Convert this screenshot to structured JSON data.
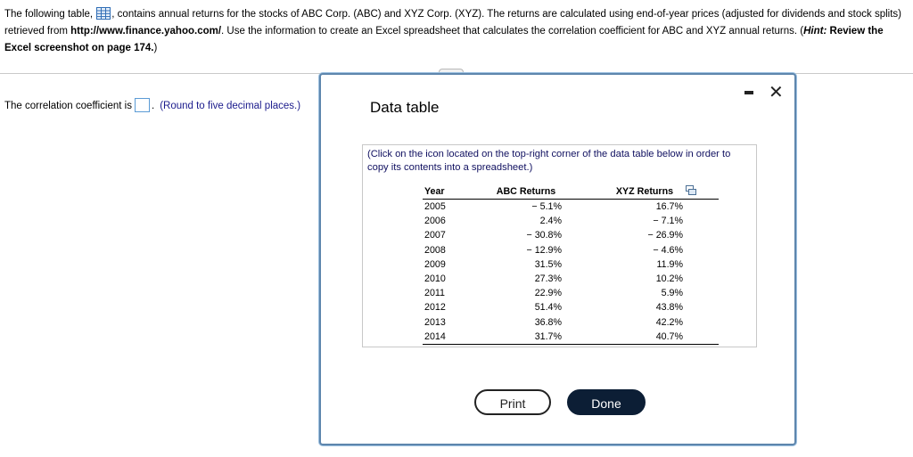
{
  "problem": {
    "part1": "The following table, ",
    "part2": ", contains annual returns for the stocks of ABC Corp. (ABC) and XYZ Corp. (XYZ). The returns are calculated using end-of-year prices (adjusted for dividends and stock splits) retrieved from ",
    "url": "http://www.finance.yahoo.com/",
    "part3": ". Use the information to create an Excel spreadsheet that calculates the correlation coefficient for ABC and XYZ annual returns. (",
    "hint_label": "Hint:",
    "hint_text": " Review the Excel screenshot on page 174.",
    "part4": ")"
  },
  "answer": {
    "prefix": "The correlation coefficient is",
    "suffix": ".",
    "hint": "(Round to five decimal places.)",
    "value": ""
  },
  "modal": {
    "title": "Data table",
    "instructions": "(Click on the icon located on the top-right corner of the data table below in order to copy its contents into a spreadsheet.)",
    "columns": [
      "Year",
      "ABC Returns",
      "XYZ Returns"
    ],
    "rows": [
      [
        "2005",
        "− 5.1%",
        "16.7%"
      ],
      [
        "2006",
        "2.4%",
        "− 7.1%"
      ],
      [
        "2007",
        "− 30.8%",
        "− 26.9%"
      ],
      [
        "2008",
        "− 12.9%",
        "− 4.6%"
      ],
      [
        "2009",
        "31.5%",
        "11.9%"
      ],
      [
        "2010",
        "27.3%",
        "10.2%"
      ],
      [
        "2011",
        "22.9%",
        "5.9%"
      ],
      [
        "2012",
        "51.4%",
        "43.8%"
      ],
      [
        "2013",
        "36.8%",
        "42.2%"
      ],
      [
        "2014",
        "31.7%",
        "40.7%"
      ]
    ],
    "print_label": "Print",
    "done_label": "Done",
    "close_symbol": "✕"
  },
  "icons": {
    "table": "table-icon",
    "copy": "copy-to-spreadsheet-icon",
    "minimize": "minimize-icon",
    "close": "close-icon"
  },
  "colors": {
    "modal_border": "#5e86ad",
    "done_button": "#0c1e35",
    "answer_box_border": "#5b9bd5",
    "instruction_text": "#101060"
  }
}
